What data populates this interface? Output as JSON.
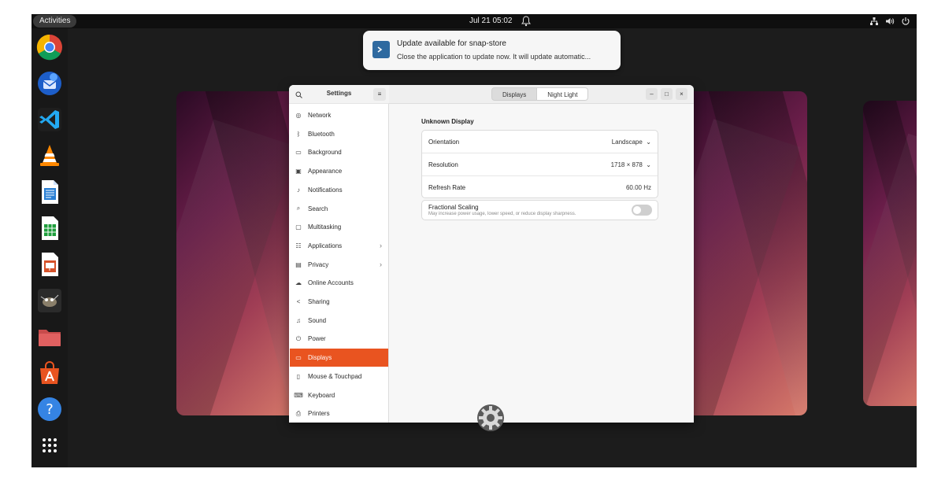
{
  "topbar": {
    "activities_label": "Activities",
    "clock": "Jul 21  05:02"
  },
  "dock": {
    "items": [
      {
        "name": "chrome",
        "label": "Chrome"
      },
      {
        "name": "thunderbird",
        "label": "Thunderbird"
      },
      {
        "name": "vscode",
        "label": "VS Code"
      },
      {
        "name": "vlc",
        "label": "VLC"
      },
      {
        "name": "writer",
        "label": "LibreOffice Writer"
      },
      {
        "name": "calc",
        "label": "LibreOffice Calc"
      },
      {
        "name": "impress",
        "label": "LibreOffice Impress"
      },
      {
        "name": "gimp",
        "label": "GIMP"
      },
      {
        "name": "files",
        "label": "Files"
      },
      {
        "name": "software",
        "label": "Ubuntu Software"
      },
      {
        "name": "help",
        "label": "Help"
      },
      {
        "name": "app-grid",
        "label": "Show Applications"
      }
    ]
  },
  "notification": {
    "title": "Update available for snap-store",
    "body": "Close the application to update now. It will update automatic..."
  },
  "settings": {
    "sidebar_title": "Settings",
    "menu_glyph": "≡",
    "items": [
      {
        "label": "Network",
        "icon": "network-icon"
      },
      {
        "label": "Bluetooth",
        "icon": "bluetooth-icon"
      },
      {
        "label": "Background",
        "icon": "background-icon"
      },
      {
        "label": "Appearance",
        "icon": "appearance-icon"
      },
      {
        "label": "Notifications",
        "icon": "bell-icon"
      },
      {
        "label": "Search",
        "icon": "search-icon"
      },
      {
        "label": "Multitasking",
        "icon": "multitasking-icon"
      },
      {
        "label": "Applications",
        "icon": "apps-icon",
        "chevron": "›"
      },
      {
        "label": "Privacy",
        "icon": "lock-icon",
        "chevron": "›"
      },
      {
        "label": "Online Accounts",
        "icon": "cloud-icon"
      },
      {
        "label": "Sharing",
        "icon": "share-icon"
      },
      {
        "label": "Sound",
        "icon": "music-icon"
      },
      {
        "label": "Power",
        "icon": "power-icon"
      },
      {
        "label": "Displays",
        "icon": "display-icon",
        "active": true
      },
      {
        "label": "Mouse & Touchpad",
        "icon": "mouse-icon"
      },
      {
        "label": "Keyboard",
        "icon": "keyboard-icon"
      },
      {
        "label": "Printers",
        "icon": "printer-icon"
      }
    ],
    "tabs": [
      "Displays",
      "Night Light"
    ],
    "window_buttons": {
      "minimize": "–",
      "maximize": "□",
      "close": "×"
    },
    "display_name": "Unknown Display",
    "rows": [
      {
        "label": "Orientation",
        "value": "Landscape",
        "dropdown": "⌄"
      },
      {
        "label": "Resolution",
        "value": "1718 × 878",
        "dropdown": "⌄"
      },
      {
        "label": "Refresh Rate",
        "value": "60.00 Hz"
      }
    ],
    "fractional_scaling": {
      "title": "Fractional Scaling",
      "subtitle": "May increase power usage, lower speed, or reduce display sharpness."
    }
  }
}
